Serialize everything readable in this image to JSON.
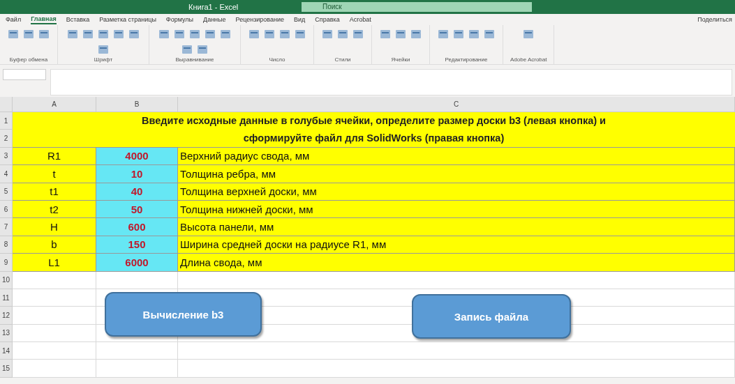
{
  "window": {
    "title": "Книга1 - Excel",
    "search": "Поиск"
  },
  "ribbon": {
    "tabs": [
      {
        "label": "Файл",
        "selected": false
      },
      {
        "label": "Главная",
        "selected": true
      },
      {
        "label": "Вставка",
        "selected": false
      },
      {
        "label": "Разметка страницы",
        "selected": false
      },
      {
        "label": "Формулы",
        "selected": false
      },
      {
        "label": "Данные",
        "selected": false
      },
      {
        "label": "Рецензирование",
        "selected": false
      },
      {
        "label": "Вид",
        "selected": false
      },
      {
        "label": "Справка",
        "selected": false
      },
      {
        "label": "Acrobat",
        "selected": false
      }
    ],
    "share": "Поделиться",
    "groups": [
      {
        "label": "Буфер обмена"
      },
      {
        "label": "Шрифт"
      },
      {
        "label": "Выравнивание"
      },
      {
        "label": "Число"
      },
      {
        "label": "Стили"
      },
      {
        "label": "Ячейки"
      },
      {
        "label": "Редактирование"
      },
      {
        "label": "Adobe Acrobat"
      }
    ]
  },
  "sheet": {
    "columns": [
      "A",
      "B",
      "C"
    ],
    "rows": [
      "1",
      "2",
      "3",
      "4",
      "5",
      "6",
      "7",
      "8",
      "9",
      "10",
      "11",
      "12",
      "13",
      "14",
      "15"
    ],
    "header": [
      "Введите исходные данные в голубые ячейки, определите размер доски b3 (левая кнопка) и",
      "сформируйте файл для SolidWorks (правая кнопка)"
    ],
    "params": [
      {
        "name": "R1",
        "value": "4000",
        "description": "Верхний радиус свода, мм"
      },
      {
        "name": "t",
        "value": "10",
        "description": "Толщина ребра, мм"
      },
      {
        "name": "t1",
        "value": "40",
        "description": "Толщина верхней доски, мм"
      },
      {
        "name": "t2",
        "value": "50",
        "description": "Толщина нижней доски, мм"
      },
      {
        "name": "H",
        "value": "600",
        "description": "Высота панели, мм"
      },
      {
        "name": "b",
        "value": "150",
        "description": "Ширина средней доски на радиусе R1, мм"
      },
      {
        "name": "L1",
        "value": "6000",
        "description": "Длина свода, мм"
      }
    ],
    "buttons": [
      "Вычисление b3",
      "Запись файла"
    ]
  }
}
